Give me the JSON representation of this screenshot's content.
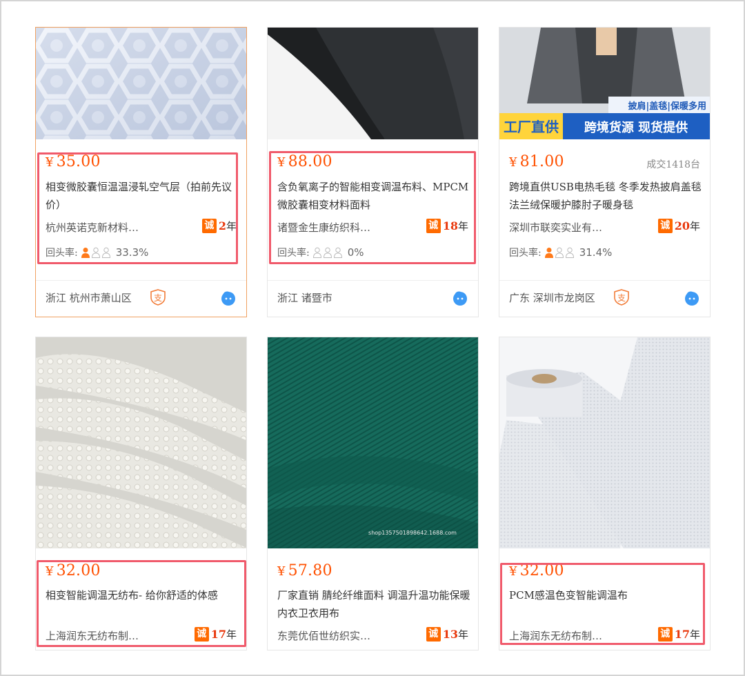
{
  "products": [
    {
      "price": "35.00",
      "title": "相变微胶囊恒温温浸轧空气层（拍前先议价）",
      "company": "杭州英诺克新材料…",
      "years": "2",
      "repeat_label": "回头率:",
      "repeat_rate": "33.3%",
      "location": "浙江 杭州市萧山区",
      "alipay_badge": "支",
      "image_icon": "quilted-white-fabric-image"
    },
    {
      "price": "88.00",
      "title": "含负氧离子的智能相变调温布料、MPCM微胶囊相变材料面料",
      "company": "诸暨金生康纺织科…",
      "years": "18",
      "repeat_label": "回头率:",
      "repeat_rate": "0%",
      "location": "浙江 诸暨市",
      "image_icon": "dark-grey-fabric-image"
    },
    {
      "price": "81.00",
      "deals": "成交1418台",
      "title": "跨境直供USB电热毛毯 冬季发热披肩盖毯法兰绒保暖护膝肘子暖身毯",
      "company": "深圳市联奕实业有…",
      "years": "20",
      "repeat_label": "回头率:",
      "repeat_rate": "31.4%",
      "location": "广东 深圳市龙岗区",
      "alipay_badge": "支",
      "image_icon": "blanket-shawl-image",
      "image_tag": "披肩|盖毯|保暖多用",
      "image_banner_left": "工厂直供",
      "image_banner_right": "跨境货源 现货提供"
    },
    {
      "price": "32.00",
      "title": "相变智能调温无纺布- 给你舒适的体感",
      "company": "上海润东无纺布制…",
      "years": "17",
      "image_icon": "white-textured-fabric-image"
    },
    {
      "price": "57.80",
      "title": "厂家直销 腈纶纤维面料 调温升温功能保暖内衣卫衣用布",
      "company": "东莞优佰世纺织实…",
      "years": "13",
      "image_icon": "green-knit-fabric-image",
      "image_watermark": "shop1357501898642.1688.com"
    },
    {
      "price": "32.00",
      "title": "PCM感温色变智能调温布",
      "company": "上海润东无纺布制…",
      "years": "17",
      "image_icon": "white-fabric-rolls-image"
    }
  ],
  "labels": {
    "currency": "¥",
    "cheng_badge": "诚",
    "year_suffix": "年"
  },
  "colors": {
    "price": "#ff5000",
    "highlight": "#f05a6b",
    "cheng": "#ff6a00"
  }
}
